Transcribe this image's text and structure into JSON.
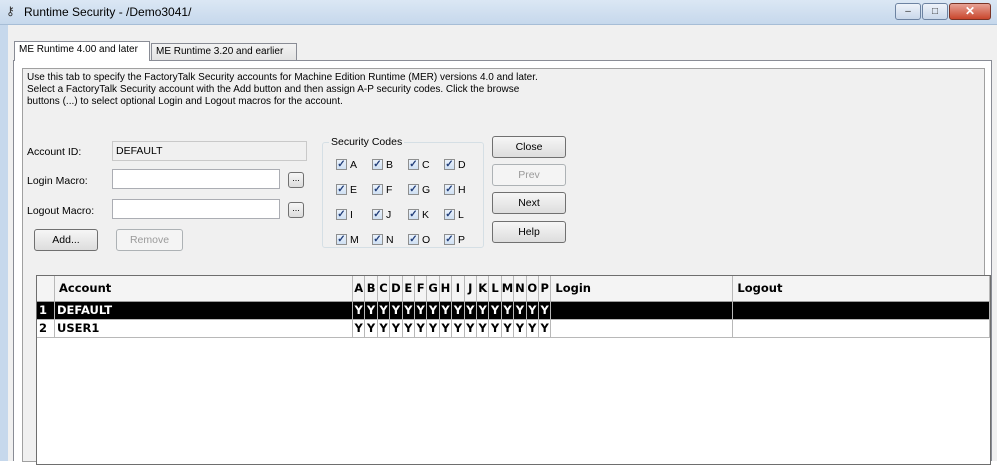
{
  "window": {
    "title": "Runtime Security - /Demo3041/",
    "controls": {
      "minimize": "–",
      "maximize": "□",
      "close": "✕"
    }
  },
  "tabs": [
    {
      "label": "ME Runtime 4.00 and later",
      "active": true
    },
    {
      "label": "ME Runtime 3.20 and earlier",
      "active": false
    }
  ],
  "description": [
    "Use this tab to specify the FactoryTalk Security accounts for Machine Edition Runtime (MER) versions 4.0 and later.",
    "Select a FactoryTalk Security account with the Add button and then assign A-P security codes.  Click the browse",
    "buttons (...) to select optional Login and Logout macros for the account."
  ],
  "form": {
    "account_id_label": "Account ID:",
    "account_id_value": "DEFAULT",
    "login_macro_label": "Login Macro:",
    "login_macro_value": "",
    "logout_macro_label": "Logout Macro:",
    "logout_macro_value": "",
    "browse_label": "...",
    "add_label": "Add...",
    "remove_label": "Remove"
  },
  "security_codes": {
    "title": "Security Codes",
    "codes": [
      {
        "label": "A",
        "checked": true
      },
      {
        "label": "B",
        "checked": true
      },
      {
        "label": "C",
        "checked": true
      },
      {
        "label": "D",
        "checked": true
      },
      {
        "label": "E",
        "checked": true
      },
      {
        "label": "F",
        "checked": true
      },
      {
        "label": "G",
        "checked": true
      },
      {
        "label": "H",
        "checked": true
      },
      {
        "label": "I",
        "checked": true
      },
      {
        "label": "J",
        "checked": true
      },
      {
        "label": "K",
        "checked": true
      },
      {
        "label": "L",
        "checked": true
      },
      {
        "label": "M",
        "checked": true
      },
      {
        "label": "N",
        "checked": true
      },
      {
        "label": "O",
        "checked": true
      },
      {
        "label": "P",
        "checked": true
      }
    ],
    "check_glyph": "✓"
  },
  "buttons": {
    "close": "Close",
    "prev": "Prev",
    "next": "Next",
    "help": "Help"
  },
  "grid": {
    "headers": {
      "account": "Account",
      "codes": [
        "A",
        "B",
        "C",
        "D",
        "E",
        "F",
        "G",
        "H",
        "I",
        "J",
        "K",
        "L",
        "M",
        "N",
        "O",
        "P"
      ],
      "login": "Login",
      "logout": "Logout"
    },
    "rows": [
      {
        "num": "1",
        "account": "DEFAULT",
        "codes": [
          "Y",
          "Y",
          "Y",
          "Y",
          "Y",
          "Y",
          "Y",
          "Y",
          "Y",
          "Y",
          "Y",
          "Y",
          "Y",
          "Y",
          "Y",
          "Y"
        ],
        "login": "",
        "logout": "",
        "selected": true
      },
      {
        "num": "2",
        "account": "USER1",
        "codes": [
          "Y",
          "Y",
          "Y",
          "Y",
          "Y",
          "Y",
          "Y",
          "Y",
          "Y",
          "Y",
          "Y",
          "Y",
          "Y",
          "Y",
          "Y",
          "Y"
        ],
        "login": "",
        "logout": "",
        "selected": false
      }
    ]
  }
}
